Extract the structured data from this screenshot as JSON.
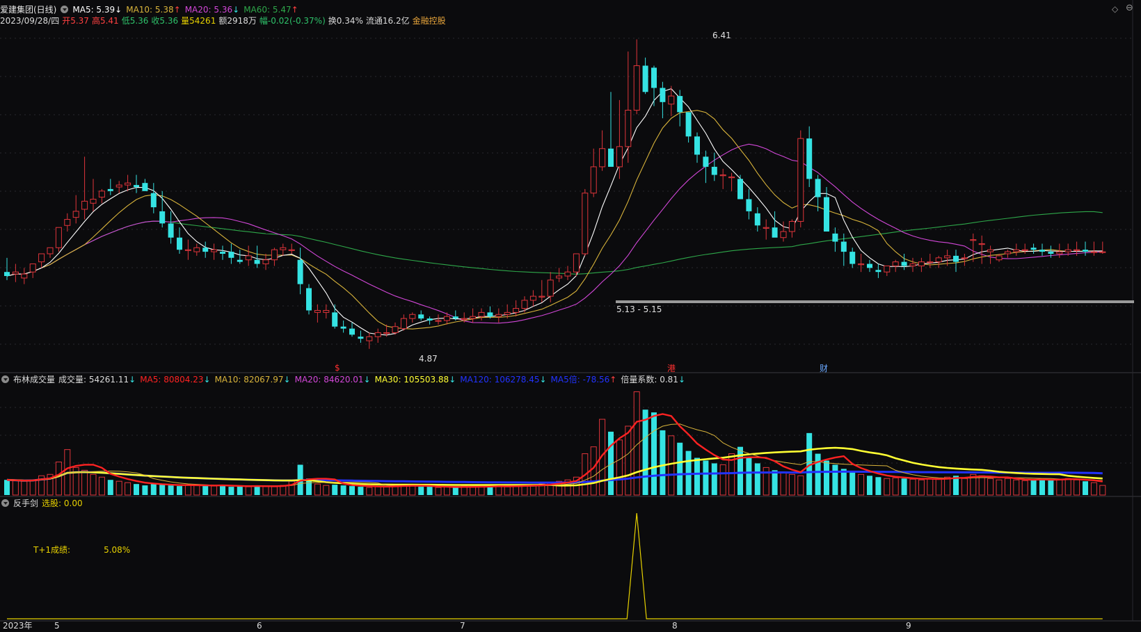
{
  "header": {
    "title": "爱建集团(日线)",
    "ma5": "MA5: 5.39",
    "ma5_arrow": "↓",
    "ma10": "MA10: 5.38",
    "ma10_arrow": "↑",
    "ma20": "MA20: 5.36",
    "ma20_arrow": "↓",
    "ma60": "MA60: 5.47",
    "ma60_arrow": "↑",
    "date": "2023/09/28/四",
    "open": "开5.37",
    "high": "高5.41",
    "low": "低5.36",
    "close": "收5.36",
    "volume": "量54261",
    "amount": "额2918万",
    "change": "幅-0.02(-0.37%)",
    "turnover": "换0.34%",
    "float": "流通16.2亿",
    "concept": "金融控股"
  },
  "volume_panel": {
    "title": "布林成交量",
    "vol": "成交量: 54261.11",
    "ma5": "MA5: 80804.23",
    "ma10": "MA10: 82067.97",
    "ma20": "MA20: 84620.01",
    "ma30": "MA30: 105503.88",
    "ma120": "MA120: 106278.45",
    "ma5b": "MA5倍: -78.56",
    "ratio": "倍量系数: 0.81",
    "down": "↓",
    "up": "↑"
  },
  "indicator_panel": {
    "title": "反手剑",
    "select": "选股: 0.00",
    "t1_label": "T+1成绩:",
    "t1_value": "5.08%"
  },
  "annotations": {
    "high_label": "6.41",
    "low_label": "4.87",
    "range_label": "5.13 - 5.15",
    "marker_s": "$",
    "marker_gang": "港",
    "marker_cai": "财"
  },
  "axis": {
    "year": "2023年",
    "months": [
      "5",
      "6",
      "7",
      "8",
      "9"
    ]
  },
  "colors": {
    "up": "#e0353b",
    "down": "#35e3e3",
    "ma5": "#ffffff",
    "ma10": "#d9b43b",
    "ma20": "#d247d8",
    "ma60": "#2ea84a",
    "vol_ma5": "#ff2222",
    "vol_ma20": "#ffff33",
    "vol_ma120": "#2233ff",
    "indicator": "#e8d200"
  },
  "chart_data": {
    "type": "candlestick",
    "ylim": [
      4.8,
      6.45
    ],
    "x": [
      0,
      1,
      2,
      3,
      4,
      5,
      6,
      7,
      8,
      9,
      10,
      11,
      12,
      13,
      14,
      15,
      16,
      17,
      18,
      19,
      20,
      21,
      22,
      23,
      24,
      25,
      26,
      27,
      28,
      29,
      30,
      31,
      32,
      33,
      34,
      35,
      36,
      37,
      38,
      39,
      40,
      41,
      42,
      43,
      44,
      45,
      46,
      47,
      48,
      49,
      50,
      51,
      52,
      53,
      54,
      55,
      56,
      57,
      58,
      59,
      60,
      61,
      62,
      63,
      64,
      65,
      66,
      67,
      68,
      69,
      70,
      71,
      72,
      73,
      74,
      75,
      76,
      77,
      78,
      79,
      80,
      81,
      82,
      83,
      84,
      85,
      86,
      87,
      88,
      89,
      90,
      91,
      92,
      93,
      94,
      95,
      96,
      97,
      98,
      99,
      100,
      101,
      102,
      103,
      104,
      105,
      106,
      107,
      108,
      109,
      110,
      111,
      112,
      113,
      114,
      115,
      116,
      117,
      118,
      119,
      120,
      121,
      122,
      123,
      124,
      125,
      126,
      127
    ],
    "open": [
      5.26,
      5.25,
      5.23,
      5.26,
      5.31,
      5.35,
      5.38,
      5.49,
      5.53,
      5.57,
      5.6,
      5.63,
      5.67,
      5.68,
      5.69,
      5.69,
      5.7,
      5.65,
      5.56,
      5.5,
      5.43,
      5.37,
      5.36,
      5.38,
      5.36,
      5.36,
      5.36,
      5.32,
      5.32,
      5.32,
      5.3,
      5.32,
      5.37,
      5.37,
      5.32,
      5.18,
      5.06,
      5.06,
      5.06,
      4.99,
      4.98,
      4.94,
      4.92,
      4.94,
      4.96,
      4.96,
      4.98,
      5.03,
      5.05,
      5.03,
      5.02,
      5.02,
      5.04,
      5.03,
      5.03,
      5.04,
      5.06,
      5.04,
      5.05,
      5.06,
      5.08,
      5.12,
      5.14,
      5.14,
      5.23,
      5.24,
      5.26,
      5.35,
      5.65,
      5.78,
      5.87,
      5.78,
      5.88,
      6.06,
      6.28,
      6.27,
      6.17,
      6.09,
      6.13,
      6.05,
      5.93,
      5.83,
      5.78,
      5.74,
      5.73,
      5.72,
      5.62,
      5.55,
      5.48,
      5.48,
      5.43,
      5.46,
      5.51,
      5.92,
      5.72,
      5.63,
      5.45,
      5.41,
      5.36,
      5.3,
      5.3,
      5.27,
      5.26,
      5.29,
      5.31,
      5.29,
      5.29,
      5.31,
      5.31,
      5.33,
      5.34,
      5.33,
      5.42,
      5.4,
      5.36,
      5.32,
      5.35,
      5.36,
      5.37,
      5.38,
      5.37,
      5.36,
      5.35,
      5.36,
      5.37,
      5.37,
      5.36,
      5.36
    ],
    "high": [
      5.33,
      5.3,
      5.28,
      5.29,
      5.32,
      5.37,
      5.45,
      5.55,
      5.64,
      5.83,
      5.72,
      5.67,
      5.72,
      5.71,
      5.74,
      5.74,
      5.72,
      5.7,
      5.66,
      5.56,
      5.48,
      5.42,
      5.4,
      5.41,
      5.4,
      5.39,
      5.4,
      5.37,
      5.39,
      5.39,
      5.35,
      5.38,
      5.4,
      5.4,
      5.38,
      5.2,
      5.1,
      5.1,
      5.1,
      5.02,
      5.01,
      4.97,
      4.96,
      4.98,
      5.0,
      5.01,
      5.05,
      5.06,
      5.07,
      5.04,
      5.05,
      5.06,
      5.07,
      5.06,
      5.08,
      5.08,
      5.09,
      5.08,
      5.1,
      5.12,
      5.14,
      5.17,
      5.22,
      5.26,
      5.28,
      5.29,
      5.31,
      5.67,
      5.87,
      5.96,
      6.15,
      6.11,
      6.35,
      6.41,
      6.32,
      6.28,
      6.2,
      6.18,
      6.16,
      6.05,
      5.95,
      5.86,
      5.85,
      5.77,
      5.75,
      5.74,
      5.67,
      5.58,
      5.52,
      5.56,
      5.51,
      5.52,
      5.96,
      5.98,
      5.74,
      5.68,
      5.48,
      5.45,
      5.38,
      5.35,
      5.32,
      5.3,
      5.29,
      5.32,
      5.35,
      5.33,
      5.33,
      5.35,
      5.34,
      5.37,
      5.37,
      5.35,
      5.45,
      5.44,
      5.39,
      5.35,
      5.37,
      5.4,
      5.4,
      5.4,
      5.4,
      5.39,
      5.4,
      5.4,
      5.41,
      5.41,
      5.41,
      5.41
    ],
    "low": [
      5.22,
      5.21,
      5.2,
      5.23,
      5.28,
      5.33,
      5.36,
      5.46,
      5.5,
      5.52,
      5.56,
      5.6,
      5.64,
      5.65,
      5.66,
      5.65,
      5.67,
      5.55,
      5.48,
      5.4,
      5.35,
      5.32,
      5.34,
      5.33,
      5.32,
      5.32,
      5.3,
      5.3,
      5.29,
      5.28,
      5.27,
      5.29,
      5.34,
      5.35,
      5.15,
      5.05,
      5.01,
      5.03,
      4.98,
      4.96,
      4.94,
      4.91,
      4.88,
      4.91,
      4.94,
      4.95,
      4.97,
      5.01,
      5.02,
      5.0,
      5.0,
      5.0,
      5.02,
      5.01,
      5.01,
      5.02,
      5.03,
      5.01,
      5.03,
      5.04,
      5.06,
      5.09,
      5.11,
      5.11,
      5.21,
      5.22,
      5.24,
      5.34,
      5.63,
      5.76,
      5.85,
      5.72,
      5.8,
      6.04,
      6.14,
      6.08,
      6.02,
      6.03,
      5.98,
      5.9,
      5.8,
      5.7,
      5.71,
      5.67,
      5.66,
      5.62,
      5.52,
      5.46,
      5.42,
      5.44,
      5.41,
      5.43,
      5.48,
      5.68,
      5.56,
      5.46,
      5.36,
      5.29,
      5.28,
      5.26,
      5.26,
      5.23,
      5.24,
      5.26,
      5.27,
      5.26,
      5.26,
      5.28,
      5.28,
      5.29,
      5.26,
      5.29,
      5.31,
      5.3,
      5.3,
      5.31,
      5.33,
      5.34,
      5.35,
      5.35,
      5.34,
      5.33,
      5.33,
      5.34,
      5.34,
      5.34,
      5.34,
      5.35
    ],
    "close": [
      5.24,
      5.26,
      5.25,
      5.3,
      5.35,
      5.38,
      5.48,
      5.52,
      5.56,
      5.61,
      5.62,
      5.66,
      5.66,
      5.69,
      5.7,
      5.68,
      5.66,
      5.58,
      5.5,
      5.43,
      5.37,
      5.37,
      5.38,
      5.36,
      5.37,
      5.35,
      5.33,
      5.31,
      5.34,
      5.3,
      5.32,
      5.37,
      5.38,
      5.37,
      5.2,
      5.07,
      5.07,
      5.07,
      4.99,
      4.98,
      4.95,
      4.93,
      4.94,
      4.96,
      4.96,
      4.99,
      5.03,
      5.05,
      5.03,
      5.02,
      5.02,
      5.04,
      5.03,
      5.03,
      5.04,
      5.06,
      5.04,
      5.05,
      5.06,
      5.08,
      5.12,
      5.14,
      5.14,
      5.22,
      5.24,
      5.26,
      5.35,
      5.65,
      5.78,
      5.87,
      5.78,
      5.88,
      6.06,
      6.28,
      6.15,
      6.17,
      6.1,
      6.13,
      6.05,
      5.93,
      5.84,
      5.78,
      5.74,
      5.74,
      5.73,
      5.62,
      5.56,
      5.49,
      5.48,
      5.43,
      5.46,
      5.51,
      5.92,
      5.72,
      5.63,
      5.46,
      5.41,
      5.36,
      5.3,
      5.3,
      5.28,
      5.26,
      5.29,
      5.31,
      5.29,
      5.3,
      5.31,
      5.31,
      5.33,
      5.34,
      5.31,
      5.33,
      5.42,
      5.4,
      5.37,
      5.34,
      5.36,
      5.37,
      5.37,
      5.37,
      5.36,
      5.35,
      5.36,
      5.37,
      5.37,
      5.36,
      5.36,
      5.36
    ],
    "volume": [
      22,
      21,
      20,
      22,
      28,
      30,
      48,
      66,
      40,
      36,
      30,
      26,
      22,
      20,
      18,
      16,
      14,
      16,
      15,
      14,
      13,
      14,
      15,
      14,
      13,
      14,
      12,
      13,
      12,
      14,
      13,
      12,
      14,
      20,
      44,
      24,
      16,
      14,
      15,
      14,
      13,
      12,
      11,
      12,
      13,
      15,
      14,
      13,
      12,
      12,
      11,
      12,
      11,
      13,
      12,
      12,
      13,
      14,
      12,
      13,
      14,
      15,
      16,
      18,
      20,
      22,
      26,
      60,
      70,
      110,
      92,
      80,
      100,
      150,
      124,
      120,
      94,
      86,
      76,
      64,
      54,
      50,
      46,
      44,
      60,
      70,
      54,
      46,
      40,
      36,
      32,
      30,
      28,
      90,
      60,
      50,
      44,
      38,
      34,
      30,
      28,
      26,
      24,
      25,
      24,
      23,
      22,
      24,
      23,
      26,
      28,
      24,
      30,
      28,
      24,
      22,
      24,
      22,
      21,
      22,
      24,
      22,
      23,
      24,
      22,
      20,
      18,
      14
    ],
    "indicator_spike_index": 73
  }
}
